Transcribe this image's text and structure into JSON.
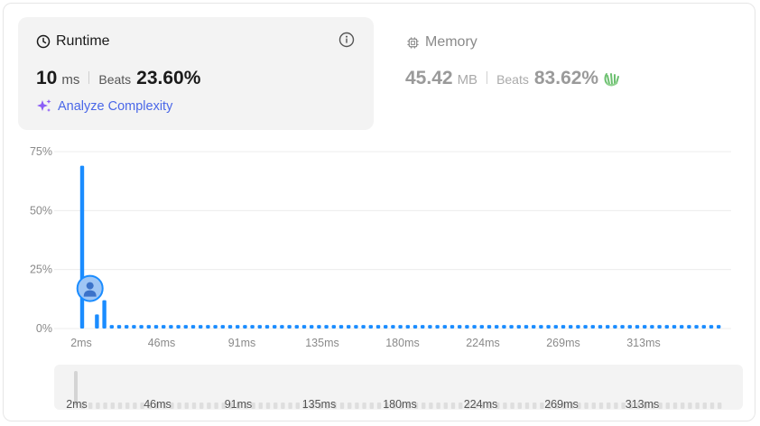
{
  "runtime": {
    "title": "Runtime",
    "value": "10",
    "unit": "ms",
    "beats_label": "Beats",
    "beats_value": "23.60%",
    "analyze_label": "Analyze Complexity"
  },
  "memory": {
    "title": "Memory",
    "value": "45.42",
    "unit": "MB",
    "beats_label": "Beats",
    "beats_value": "83.62%"
  },
  "colors": {
    "bar": "#1a8cff",
    "accent": "#4a67e8",
    "sparkle": "#8b5cf6",
    "grid": "#ececec"
  },
  "icons": {
    "clock": "clock-icon",
    "info": "info-icon",
    "chip": "chip-icon",
    "sparkle": "sparkle-icon",
    "clap": "clap-icon",
    "user": "user-avatar-icon"
  },
  "chart_data": {
    "type": "bar",
    "y_ticks": [
      "75%",
      "50%",
      "25%",
      "0%"
    ],
    "ylim": [
      0,
      75
    ],
    "x_ticks": [
      "2ms",
      "46ms",
      "91ms",
      "135ms",
      "180ms",
      "224ms",
      "269ms",
      "313ms"
    ],
    "bar_values": [
      69,
      0,
      6,
      12,
      1.5,
      1.5,
      1.5,
      1.5,
      1.5,
      1.5,
      1.5,
      1.5,
      1.5,
      1.5,
      1.5,
      1.5,
      1.5,
      1.5,
      1.5,
      1.5,
      1.5,
      1.5,
      1.5,
      1.5,
      1.5,
      1.5,
      1.5,
      1.5,
      1.5,
      1.5,
      1.5,
      1.5,
      1.5,
      1.5,
      1.5,
      1.5,
      1.5,
      1.5,
      1.5,
      1.5,
      1.5,
      1.5,
      1.5,
      1.5,
      1.5,
      1.5,
      1.5,
      1.5,
      1.5,
      1.5,
      1.5,
      1.5,
      1.5,
      1.5,
      1.5,
      1.5,
      1.5,
      1.5,
      1.5,
      1.5,
      1.5,
      1.5,
      1.5,
      1.5,
      1.5,
      1.5,
      1.5,
      1.5,
      1.5,
      1.5,
      1.5,
      1.5,
      1.5,
      1.5,
      1.5,
      1.5,
      1.5,
      1.5,
      1.5,
      1.5,
      1.5,
      1.5,
      1.5,
      1.5,
      1.5,
      1.5,
      1.5
    ],
    "user_bar_index": 1,
    "user_value": 17
  },
  "navigator": {
    "x_ticks": [
      "2ms",
      "46ms",
      "91ms",
      "135ms",
      "180ms",
      "224ms",
      "269ms",
      "313ms"
    ]
  }
}
